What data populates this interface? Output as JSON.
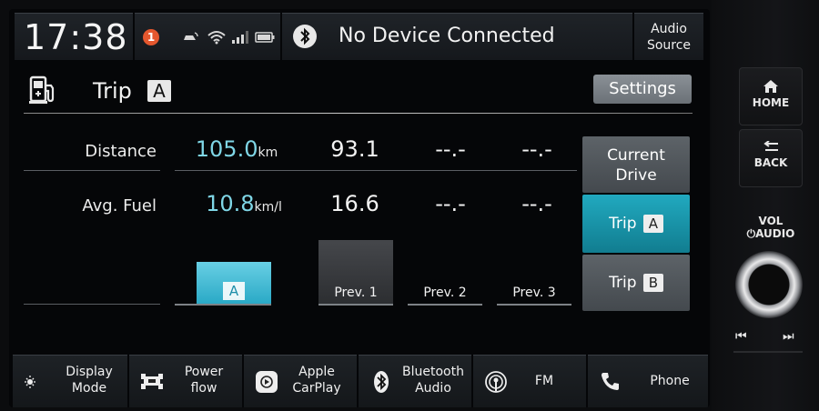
{
  "status": {
    "clock": "17:38",
    "notification_count": "1",
    "bluetooth_text": "No Device Connected",
    "audio_source_line1": "Audio",
    "audio_source_line2": "Source"
  },
  "header": {
    "trip_label": "Trip",
    "trip_letter": "A",
    "settings_label": "Settings"
  },
  "table": {
    "rows": [
      {
        "label": "Distance",
        "current": "105.0",
        "unit": "km",
        "prev1": "93.1",
        "prev2": "--.-",
        "prev3": "--.-"
      },
      {
        "label": "Avg. Fuel",
        "current": "10.8",
        "unit": "km/l",
        "prev1": "16.6",
        "prev2": "--.-",
        "prev3": "--.-"
      }
    ],
    "bars": [
      {
        "label": "A",
        "value": 10.8
      },
      {
        "label": "Prev. 1",
        "value": 16.6
      },
      {
        "label": "Prev. 2",
        "value": null
      },
      {
        "label": "Prev. 3",
        "value": null
      }
    ]
  },
  "modes": {
    "current_line1": "Current",
    "current_line2": "Drive",
    "trip_a_label": "Trip",
    "trip_a_letter": "A",
    "trip_b_label": "Trip",
    "trip_b_letter": "B"
  },
  "nav": {
    "display_mode_1": "Display",
    "display_mode_2": "Mode",
    "power_flow_1": "Power",
    "power_flow_2": "flow",
    "carplay_1": "Apple",
    "carplay_2": "CarPlay",
    "bt_audio_1": "Bluetooth",
    "bt_audio_2": "Audio",
    "fm": "FM",
    "phone": "Phone"
  },
  "hard_buttons": {
    "home": "HOME",
    "back": "BACK",
    "vol_1": "VOL",
    "vol_2": "AUDIO"
  },
  "colors": {
    "accent": "#21a9bf",
    "current_value": "#7fd6e6",
    "notification": "#e4572e"
  }
}
